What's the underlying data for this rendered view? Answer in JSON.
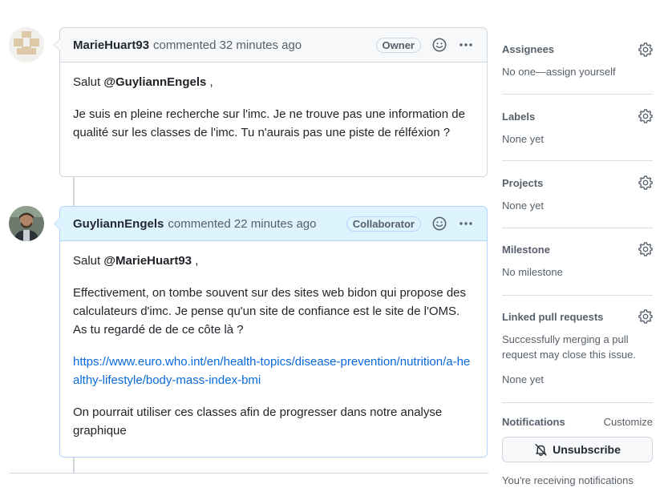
{
  "comments": [
    {
      "author": "MarieHuart93",
      "action": "commented 32 minutes ago",
      "role": "Owner",
      "greeting_prefix": "Salut ",
      "mention": "@GuyliannEngels",
      "greeting_suffix": " ,",
      "paragraphs": [
        "Je suis en pleine recherche sur l'imc. Je ne trouve pas une information de qualité sur les classes de l'imc. Tu n'aurais pas une piste de rélféxion ?"
      ]
    },
    {
      "author": "GuyliannEngels",
      "action": "commented 22 minutes ago",
      "role": "Collaborator",
      "greeting_prefix": "Salut ",
      "mention": "@MarieHuart93",
      "greeting_suffix": " ,",
      "paragraphs": [
        "Effectivement, on tombe souvent sur des sites web bidon qui propose des calculateurs d'imc. Je pense qu'un site de confiance est le site de l'OMS. As tu regardé de de ce côte là ?",
        "On pourrait utiliser ces classes afin de progresser dans notre analyse graphique"
      ],
      "link": "https://www.euro.who.int/en/health-topics/disease-prevention/nutrition/a-healthy-lifestyle/body-mass-index-bmi"
    }
  ],
  "sidebar": {
    "assignees": {
      "title": "Assignees",
      "value": "No one—assign yourself"
    },
    "labels": {
      "title": "Labels",
      "value": "None yet"
    },
    "projects": {
      "title": "Projects",
      "value": "None yet"
    },
    "milestone": {
      "title": "Milestone",
      "value": "No milestone"
    },
    "linked_prs": {
      "title": "Linked pull requests",
      "description": "Successfully merging a pull request may close this issue.",
      "value": "None yet"
    },
    "notifications": {
      "title": "Notifications",
      "customize": "Customize",
      "unsubscribe": "Unsubscribe",
      "status": "You're receiving notifications"
    }
  },
  "icons": [
    "smiley-icon",
    "kebab-menu-icon",
    "gear-icon",
    "bell-slash-icon"
  ],
  "colors": {
    "link": "#0969da",
    "collaborator_header": "#ddf4ff",
    "header": "#f6f8fa",
    "border": "#d0d7de"
  }
}
